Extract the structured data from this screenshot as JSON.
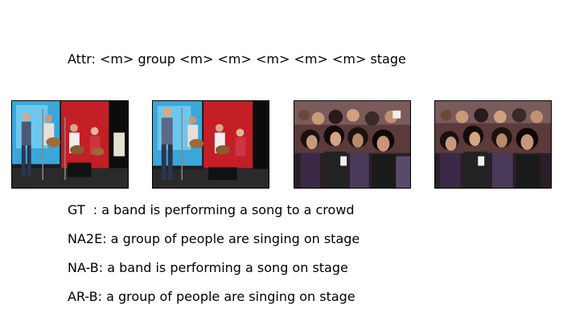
{
  "attr": {
    "text": "Attr: <m> group <m> <m> <m> <m> <m> stage"
  },
  "frames": [
    {
      "scene": "band-on-stage"
    },
    {
      "scene": "band-on-stage"
    },
    {
      "scene": "crowd"
    },
    {
      "scene": "crowd"
    }
  ],
  "captions": {
    "gt": "GT  : a band is performing a song to a crowd",
    "na2e": "NA2E: a group of people are singing on stage",
    "nab": "NA-B: a band is performing a song on stage",
    "arb": "AR-B: a group of people are singing on stage"
  }
}
